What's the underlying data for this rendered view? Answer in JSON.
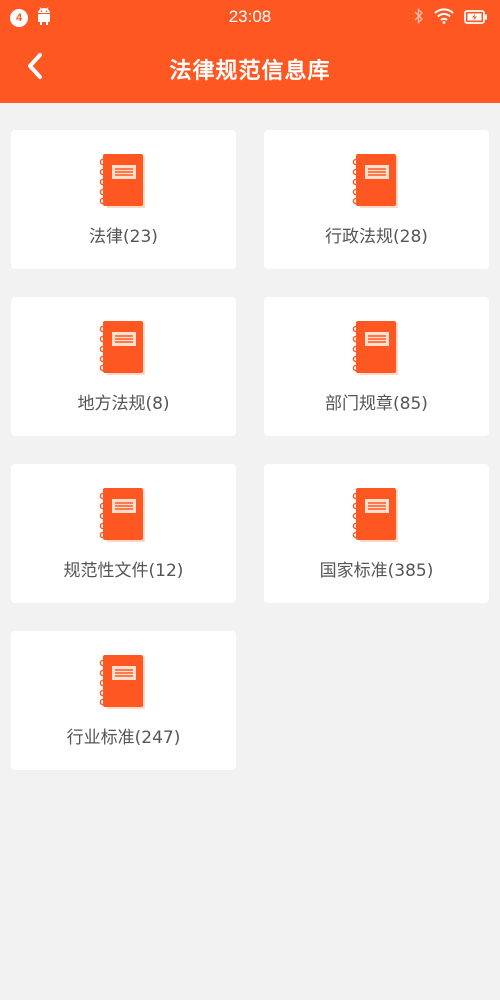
{
  "status_bar": {
    "notification_count": "4",
    "time": "23:08",
    "icons": [
      "android-icon",
      "bluetooth-icon",
      "wifi-icon",
      "battery-icon"
    ]
  },
  "header": {
    "title": "法律规范信息库",
    "back_icon": "chevron-left-icon"
  },
  "colors": {
    "accent": "#ff5722",
    "background": "#f2f2f2",
    "card": "#ffffff",
    "label": "#555555"
  },
  "categories": [
    {
      "label": "法律(23)",
      "icon": "book-icon"
    },
    {
      "label": "行政法规(28)",
      "icon": "book-icon"
    },
    {
      "label": "地方法规(8)",
      "icon": "book-icon"
    },
    {
      "label": "部门规章(85)",
      "icon": "book-icon"
    },
    {
      "label": "规范性文件(12)",
      "icon": "book-icon"
    },
    {
      "label": "国家标准(385)",
      "icon": "book-icon"
    },
    {
      "label": "行业标准(247)",
      "icon": "book-icon"
    }
  ]
}
